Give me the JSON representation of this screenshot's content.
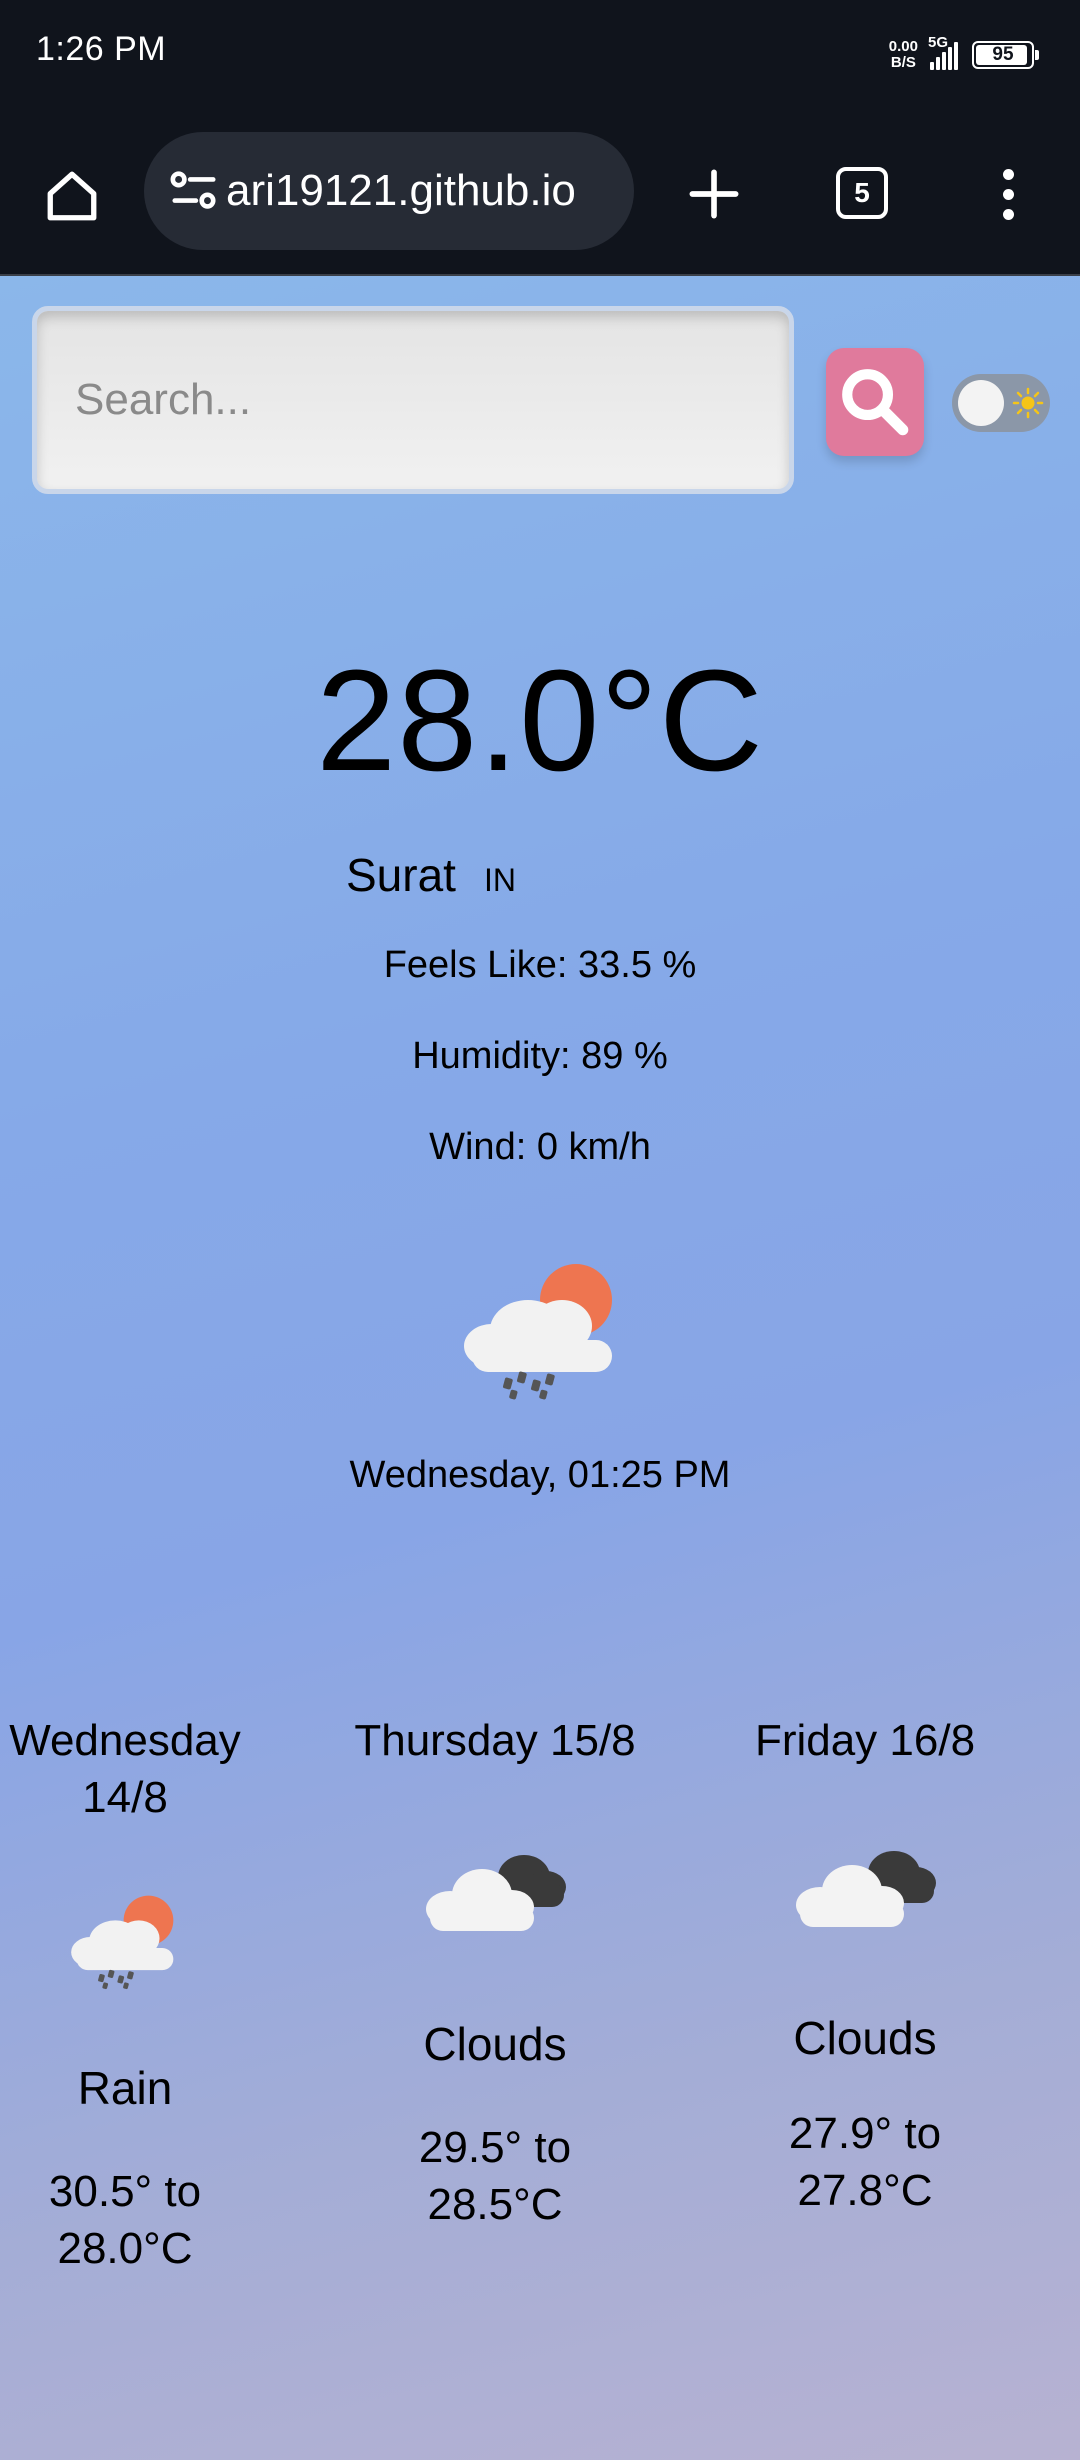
{
  "status_bar": {
    "time": "1:26 PM",
    "net_speed_value": "0.00",
    "net_speed_unit": "B/S",
    "network": "5G",
    "battery": "95",
    "battery_level_percent": 95
  },
  "browser": {
    "url": "ari19121.github.io",
    "tab_count": "5"
  },
  "search": {
    "placeholder": "Search..."
  },
  "current": {
    "temperature": "28.0°C",
    "city": "Surat",
    "country": "IN",
    "feels_like": "Feels Like: 33.5 %",
    "humidity": "Humidity: 89 %",
    "wind": "Wind: 0 km/h",
    "icon": "rain-sun-icon",
    "datetime": "Wednesday, 01:25 PM"
  },
  "forecast": [
    {
      "date": "Wednesday 14/8",
      "icon": "rain-sun-icon",
      "description": "Rain",
      "range": "30.5° to 28.0°C"
    },
    {
      "date": "Thursday 15/8",
      "icon": "clouds-icon",
      "description": "Clouds",
      "range": "29.5° to 28.5°C"
    },
    {
      "date": "Friday 16/8",
      "icon": "clouds-icon",
      "description": "Clouds",
      "range": "27.9° to 27.8°C"
    }
  ],
  "colors": {
    "search_button": "#e07a9c",
    "sun": "#ee7550",
    "toggle_sun": "#f5c518"
  }
}
